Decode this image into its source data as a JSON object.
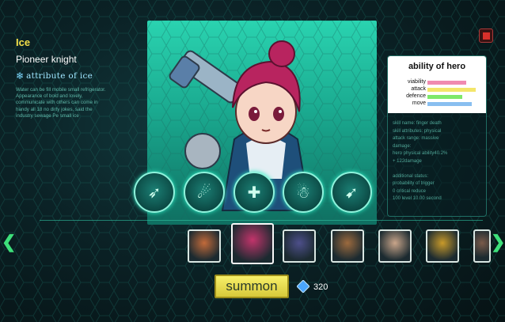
{
  "hero": {
    "name": "Ice",
    "class": "Pioneer knight",
    "attribute": "attribute of ice",
    "description": "Water can be fill mobile small refrigerator. Appearance of bold and lovely, communicate with others can come in handy all 18 no dirty jokes, said the industry sewage Pe small ice"
  },
  "ability": {
    "title": "ability of hero",
    "stats": [
      {
        "label": "viability",
        "value": 0.72,
        "color": "#f08bb0"
      },
      {
        "label": "attack",
        "value": 0.9,
        "color": "#f3e66a"
      },
      {
        "label": "defence",
        "value": 0.65,
        "color": "#7ee86a"
      },
      {
        "label": "move",
        "value": 0.82,
        "color": "#89bff0"
      }
    ],
    "skill_lines": [
      "skill name: finger death",
      "skill attributes: physical",
      "attack range: massive",
      "damage:",
      "hero physical ability40.2%",
      "+ 122damage",
      "",
      "additional status:",
      "probability of trigger",
      "0 critical reduce",
      "100 level 10.00 second"
    ]
  },
  "skills": [
    {
      "icon": "rifle-skill-icon",
      "glyph": "➶"
    },
    {
      "icon": "running-figure-skill-icon",
      "glyph": "☄"
    },
    {
      "icon": "shield-cross-skill-icon",
      "glyph": "✚"
    },
    {
      "icon": "snowman-skill-icon",
      "glyph": "☃"
    },
    {
      "icon": "wings-skill-icon",
      "glyph": "➹"
    }
  ],
  "roster": [
    {
      "name": "hero-armored-bot",
      "color": "#c26a3a"
    },
    {
      "name": "hero-ice-knight",
      "color": "#c2346b"
    },
    {
      "name": "hero-masked-soldier",
      "color": "#4d4f8a"
    },
    {
      "name": "hero-bandana-fighter",
      "color": "#9c6a3e"
    },
    {
      "name": "hero-cat-girl",
      "color": "#c9a58a"
    },
    {
      "name": "hero-golden-mech",
      "color": "#c89a2a"
    },
    {
      "name": "hero-partial",
      "color": "#7a5a4a"
    }
  ],
  "summon": {
    "label": "summon",
    "gem_count": "320"
  },
  "colors": {
    "accent": "#2ad3b0",
    "title_yellow": "#f4e04a",
    "summon_yellow": "#f7f06a"
  }
}
